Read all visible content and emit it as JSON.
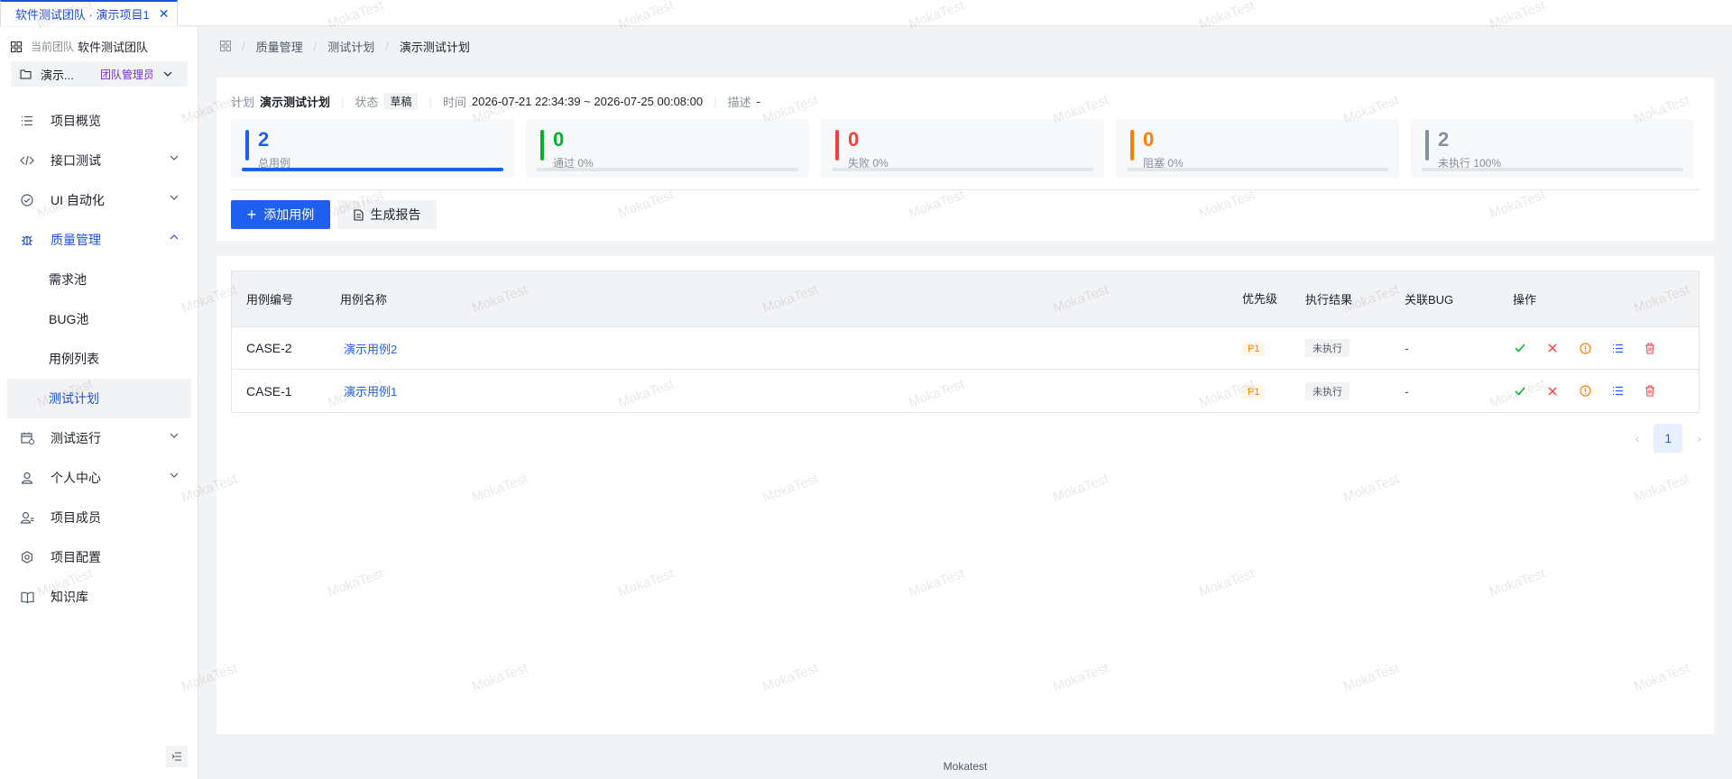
{
  "tab": {
    "title": "软件测试团队 · 演示项目1",
    "close": "✕"
  },
  "team": {
    "label": "当前团队",
    "name": "软件测试团队"
  },
  "project": {
    "name": "演示...",
    "role": "团队管理员"
  },
  "menu": {
    "overview": "项目概览",
    "api_test": "接口测试",
    "ui_auto": "UI 自动化",
    "quality": "质量管理",
    "sub": {
      "req": "需求池",
      "bug": "BUG池",
      "cases": "用例列表",
      "plans": "测试计划"
    },
    "test_run": "测试运行",
    "personal": "个人中心",
    "members": "项目成员",
    "config": "项目配置",
    "kb": "知识库"
  },
  "breadcrumb": {
    "l1": "质量管理",
    "l2": "测试计划",
    "l3": "演示测试计划"
  },
  "plan": {
    "plan_label": "计划",
    "plan_name": "演示测试计划",
    "status_label": "状态",
    "status": "草稿",
    "time_label": "时间",
    "time": "2026-07-21 22:34:39 ~ 2026-07-25 00:08:00",
    "desc_label": "描述",
    "desc": "-"
  },
  "stats": [
    {
      "num": "2",
      "label": "总用例",
      "color": "#1f5ff0",
      "fill": 1.0
    },
    {
      "num": "0",
      "label": "通过 0%",
      "color": "#00b42a",
      "fill": 0
    },
    {
      "num": "0",
      "label": "失败 0%",
      "color": "#f53f3f",
      "fill": 0
    },
    {
      "num": "0",
      "label": "阻塞 0%",
      "color": "#ff7d00",
      "fill": 0
    },
    {
      "num": "2",
      "label": "未执行 100%",
      "color": "#86909c",
      "fill": 0
    }
  ],
  "actions": {
    "add": "添加用例",
    "report": "生成报告"
  },
  "table": {
    "headers": {
      "id": "用例编号",
      "name": "用例名称",
      "priority": "优先级",
      "result": "执行结果",
      "bug": "关联BUG",
      "ops": "操作"
    },
    "rows": [
      {
        "id": "CASE-2",
        "name": "演示用例2",
        "priority": "P1",
        "result": "未执行",
        "bug": "-"
      },
      {
        "id": "CASE-1",
        "name": "演示用例1",
        "priority": "P1",
        "result": "未执行",
        "bug": "-"
      }
    ]
  },
  "pager": {
    "prev": "‹",
    "page": "1",
    "next": "›"
  },
  "footer": "Mokatest",
  "watermark": "MokaTest"
}
